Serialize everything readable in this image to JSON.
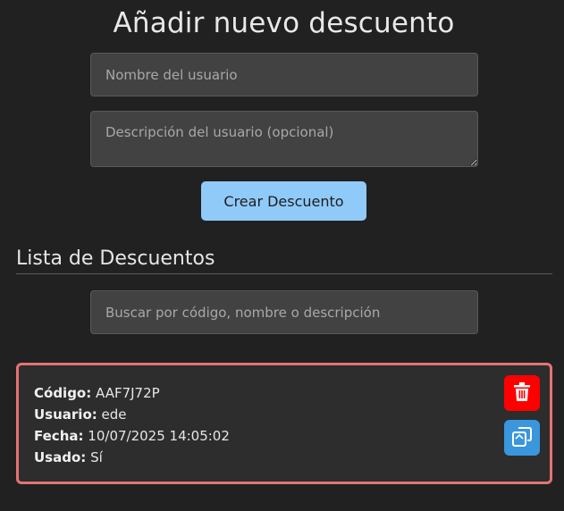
{
  "header": {
    "title": "Añadir nuevo descuento"
  },
  "form": {
    "name_placeholder": "Nombre del usuario",
    "name_value": "",
    "description_placeholder": "Descripción del usuario (opcional)",
    "description_value": "",
    "create_label": "Crear Descuento"
  },
  "list": {
    "title": "Lista de Descuentos",
    "search_placeholder": "Buscar por código, nombre o descripción",
    "search_value": "",
    "items": [
      {
        "code_label": "Código:",
        "code": "AAF7J72P",
        "user_label": "Usuario:",
        "user": "ede",
        "date_label": "Fecha:",
        "date": "10/07/2025 14:05:02",
        "used_label": "Usado:",
        "used": "Sí",
        "delete_icon": "trash-icon",
        "copy_icon": "copy-icon"
      }
    ]
  },
  "colors": {
    "background": "#212121",
    "primary_button": "#90caf9",
    "card_border": "#e57373",
    "delete": "#ff0000",
    "copy": "#3a96dd"
  }
}
